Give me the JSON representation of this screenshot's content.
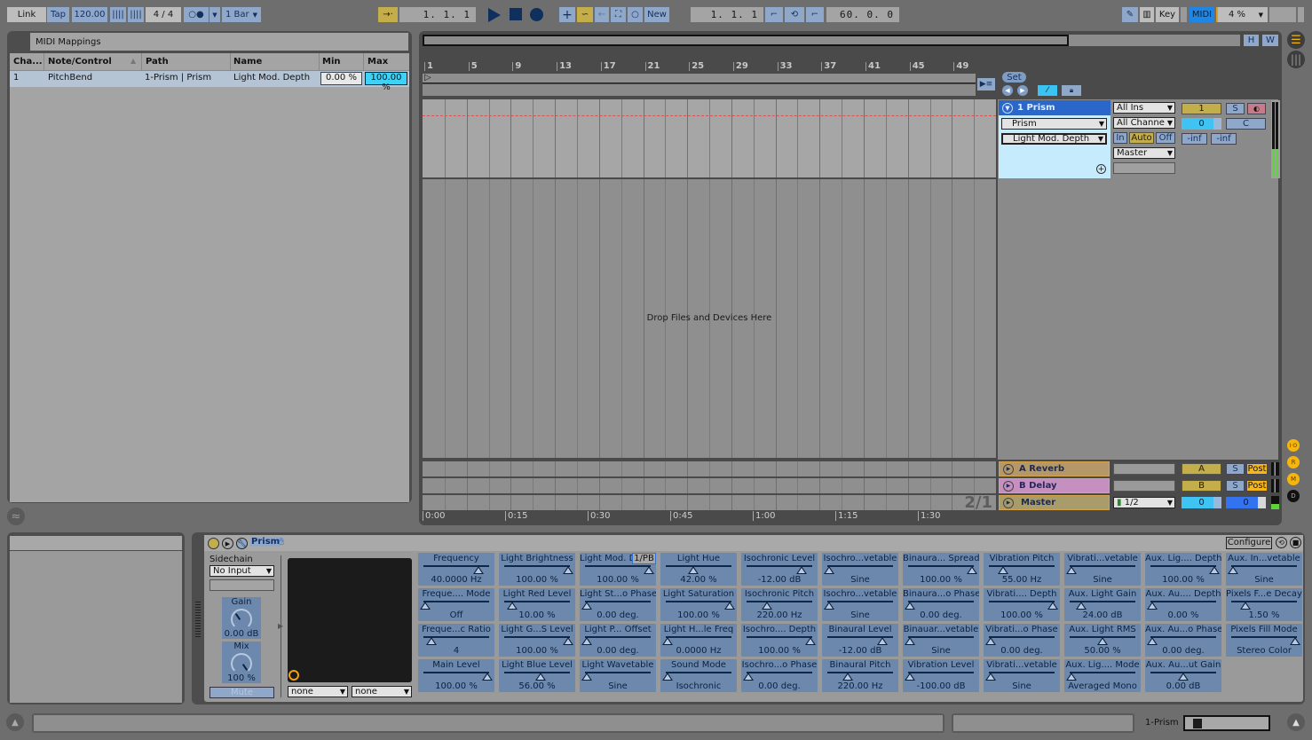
{
  "toolbar": {
    "link": "Link",
    "tap": "Tap",
    "tempo": "120.00",
    "time_signature": "4 / 4",
    "metronome": "○●",
    "quantize": "1 Bar",
    "arrangement_position": "1.  1.  1",
    "new_label": "New",
    "loop_start": "1.  1.  1",
    "loop_length": "60.  0.  0",
    "key_label": "Key",
    "midi_label": "MIDI",
    "cpu_load": "4 %"
  },
  "midi_mappings": {
    "title": "MIDI Mappings",
    "columns": [
      "Cha...",
      "Note/Control",
      "Path",
      "Name",
      "Min",
      "Max"
    ],
    "rows": [
      {
        "channel": "1",
        "note_control": "PitchBend",
        "path": "1-Prism | Prism",
        "name": "Light Mod. Depth",
        "min": "0.00 %",
        "max": "100.00 %"
      }
    ]
  },
  "arrangement": {
    "overview_buttons": {
      "h": "H",
      "w": "W"
    },
    "bar_ruler": [
      "1",
      "5",
      "9",
      "13",
      "17",
      "21",
      "25",
      "29",
      "33",
      "37",
      "41",
      "45",
      "49"
    ],
    "time_ruler": [
      "0:00",
      "0:15",
      "0:30",
      "0:45",
      "1:00",
      "1:15",
      "1:30"
    ],
    "drop_text": "Drop Files and Devices Here",
    "set_label": "Set",
    "zoom_indicator": "2/1"
  },
  "tracks": [
    {
      "name": "1 Prism",
      "device": "Prism",
      "parameter": "Light Mod. Depth",
      "input_type": "All Ins",
      "input_channel": "All Channe",
      "monitor": [
        "In",
        "Auto",
        "Off"
      ],
      "output": "Master",
      "track_number": "1",
      "solo": "S",
      "volume": "0",
      "pan": "C",
      "peak_left": "-inf",
      "peak_right": "-inf"
    }
  ],
  "returns": [
    {
      "name": "A Reverb",
      "letter": "A",
      "solo": "S",
      "post": "Post",
      "color": "#c9a46b"
    },
    {
      "name": "B Delay",
      "letter": "B",
      "solo": "S",
      "post": "Post",
      "color": "#c694c3"
    }
  ],
  "master": {
    "name": "Master",
    "output": "1/2",
    "volume": "0",
    "tempo_value": "0"
  },
  "side_indicators": [
    "I·O",
    "R",
    "M",
    "D"
  ],
  "device": {
    "title": "Prism",
    "configure": "Configure",
    "sidechain_label": "Sidechain",
    "sidechain_input": "No Input",
    "gain_label": "Gain",
    "gain_value": "0.00 dB",
    "mix_label": "Mix",
    "mix_value": "100 %",
    "mute_label": "Mute",
    "xy_x": "none",
    "xy_y": "none",
    "mapping_badge": "1/PB",
    "params": [
      [
        {
          "name": "Frequency",
          "value": "40.0000 Hz",
          "pos": 0.85
        },
        {
          "name": "Freque.... Mode",
          "value": "Off",
          "pos": 0.0
        },
        {
          "name": "Freque...c Ratio",
          "value": "4",
          "pos": 0.1
        },
        {
          "name": "Main Level",
          "value": "100.00 %",
          "pos": 1.0
        }
      ],
      [
        {
          "name": "Light Brightness",
          "value": "100.00 %",
          "pos": 1.0
        },
        {
          "name": "Light Red Level",
          "value": "10.00 %",
          "pos": 0.1
        },
        {
          "name": "Light G...S Level",
          "value": "100.00 %",
          "pos": 1.0
        },
        {
          "name": "Light Blue Level",
          "value": "56.00 %",
          "pos": 0.56
        }
      ],
      [
        {
          "name": "Light Mod. Depth",
          "value": "100.00 %",
          "pos": 1.0
        },
        {
          "name": "Light St...o Phase",
          "value": "0.00 deg.",
          "pos": 0.0
        },
        {
          "name": "Light P... Offset",
          "value": "0.00 deg.",
          "pos": 0.0
        },
        {
          "name": "Light Wavetable",
          "value": "Sine",
          "pos": 0.0
        }
      ],
      [
        {
          "name": "Light Hue",
          "value": "42.00 %",
          "pos": 0.42
        },
        {
          "name": "Light Saturation",
          "value": "100.00 %",
          "pos": 1.0
        },
        {
          "name": "Light H...le Freq",
          "value": "0.0000 Hz",
          "pos": 0.0
        },
        {
          "name": "Sound Mode",
          "value": "Isochronic",
          "pos": 0.0
        }
      ],
      [
        {
          "name": "Isochronic Level",
          "value": "-12.00 dB",
          "pos": 0.85
        },
        {
          "name": "Isochronic Pitch",
          "value": "220.00 Hz",
          "pos": 0.3
        },
        {
          "name": "Isochro.... Depth",
          "value": "100.00 %",
          "pos": 1.0
        },
        {
          "name": "Isochro...o Phase",
          "value": "0.00 deg.",
          "pos": 0.0
        }
      ],
      [
        {
          "name": "Isochro...vetable",
          "value": "Sine",
          "pos": 0.0
        },
        {
          "name": "Isochro...vetable",
          "value": "Sine",
          "pos": 0.0
        },
        {
          "name": "Binaural Level",
          "value": "-12.00 dB",
          "pos": 0.85
        },
        {
          "name": "Binaural Pitch",
          "value": "220.00 Hz",
          "pos": 0.3
        }
      ],
      [
        {
          "name": "Binaura... Spread",
          "value": "100.00 %",
          "pos": 1.0
        },
        {
          "name": "Binaura...o Phase",
          "value": "0.00 deg.",
          "pos": 0.0
        },
        {
          "name": "Binauar...vetable",
          "value": "Sine",
          "pos": 0.0
        },
        {
          "name": "Vibration Level",
          "value": "-100.00 dB",
          "pos": 0.0
        }
      ],
      [
        {
          "name": "Vibration Pitch",
          "value": "55.00 Hz",
          "pos": 0.2
        },
        {
          "name": "Vibrati.... Depth",
          "value": "100.00 %",
          "pos": 1.0
        },
        {
          "name": "Vibrati...o Phase",
          "value": "0.00 deg.",
          "pos": 0.0
        },
        {
          "name": "Vibrati...vetable",
          "value": "Sine",
          "pos": 0.0
        }
      ],
      [
        {
          "name": "Vibrati...vetable",
          "value": "Sine",
          "pos": 0.0
        },
        {
          "name": "Aux. Light Gain",
          "value": "24.00 dB",
          "pos": 0.15
        },
        {
          "name": "Aux. Light RMS",
          "value": "50.00 %",
          "pos": 0.5
        },
        {
          "name": "Aux. Lig.... Mode",
          "value": "Averaged Mono",
          "pos": 0.0
        }
      ],
      [
        {
          "name": "Aux. Lig.... Depth",
          "value": "100.00 %",
          "pos": 1.0
        },
        {
          "name": "Aux. Au.... Depth",
          "value": "0.00 %",
          "pos": 0.0
        },
        {
          "name": "Aux. Au...o Phase",
          "value": "0.00 deg.",
          "pos": 0.0
        },
        {
          "name": "Aux. Au...ut Gain",
          "value": "0.00 dB",
          "pos": 0.5
        }
      ],
      [
        {
          "name": "Aux. In...vetable",
          "value": "Sine",
          "pos": 0.0
        },
        {
          "name": "Pixels F...e Decay",
          "value": "1.50 %",
          "pos": 0.2
        },
        {
          "name": "Pixels Fill Mode",
          "value": "Stereo Color",
          "pos": 1.0
        }
      ]
    ]
  },
  "status_bar": {
    "selected_track": "1-Prism"
  }
}
